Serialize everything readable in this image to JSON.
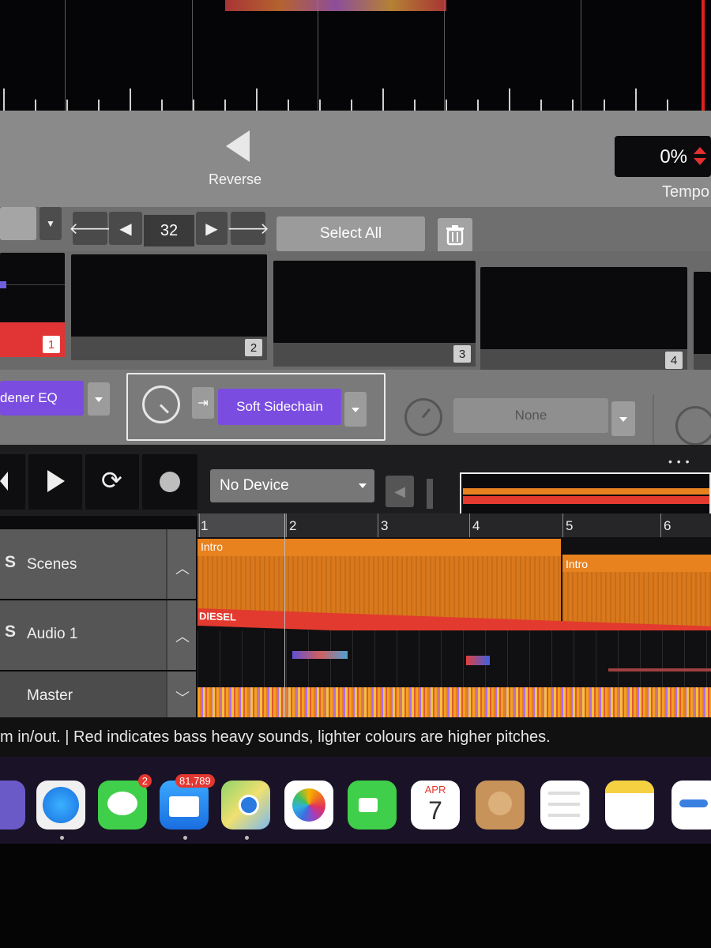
{
  "deck": {
    "reverse_label": "Reverse",
    "tempo_value": "0%",
    "tempo_label": "Tempo"
  },
  "pad_nav": {
    "count": "32",
    "select_all_label": "Select All"
  },
  "pads": [
    {
      "number": "1"
    },
    {
      "number": "2"
    },
    {
      "number": "3"
    },
    {
      "number": "4"
    }
  ],
  "effects": {
    "slot1_label": "dener EQ",
    "slot2_label": "Soft Sidechain",
    "slot3_label": "None"
  },
  "transport": {
    "device_select": "No Device",
    "more": "• • •"
  },
  "ruler": [
    "1",
    "2",
    "3",
    "4",
    "5",
    "6"
  ],
  "tracks": [
    {
      "solo": "S",
      "name": "Scenes"
    },
    {
      "solo": "S",
      "name": "Audio 1"
    },
    {
      "name": "Master"
    }
  ],
  "clips": {
    "scene1": "Intro",
    "scene2": "Intro",
    "audio": "DIESEL"
  },
  "status_text": "m in/out. | Red indicates bass heavy sounds, lighter colours are higher pitches.",
  "dock": {
    "messages_badge": "2",
    "mail_badge": "81,789",
    "calendar_month": "APR",
    "calendar_day": "7"
  },
  "colors": {
    "accent_purple": "#7a4ce0",
    "scene_orange": "#e8821f",
    "audio_red": "#e23a2e"
  }
}
